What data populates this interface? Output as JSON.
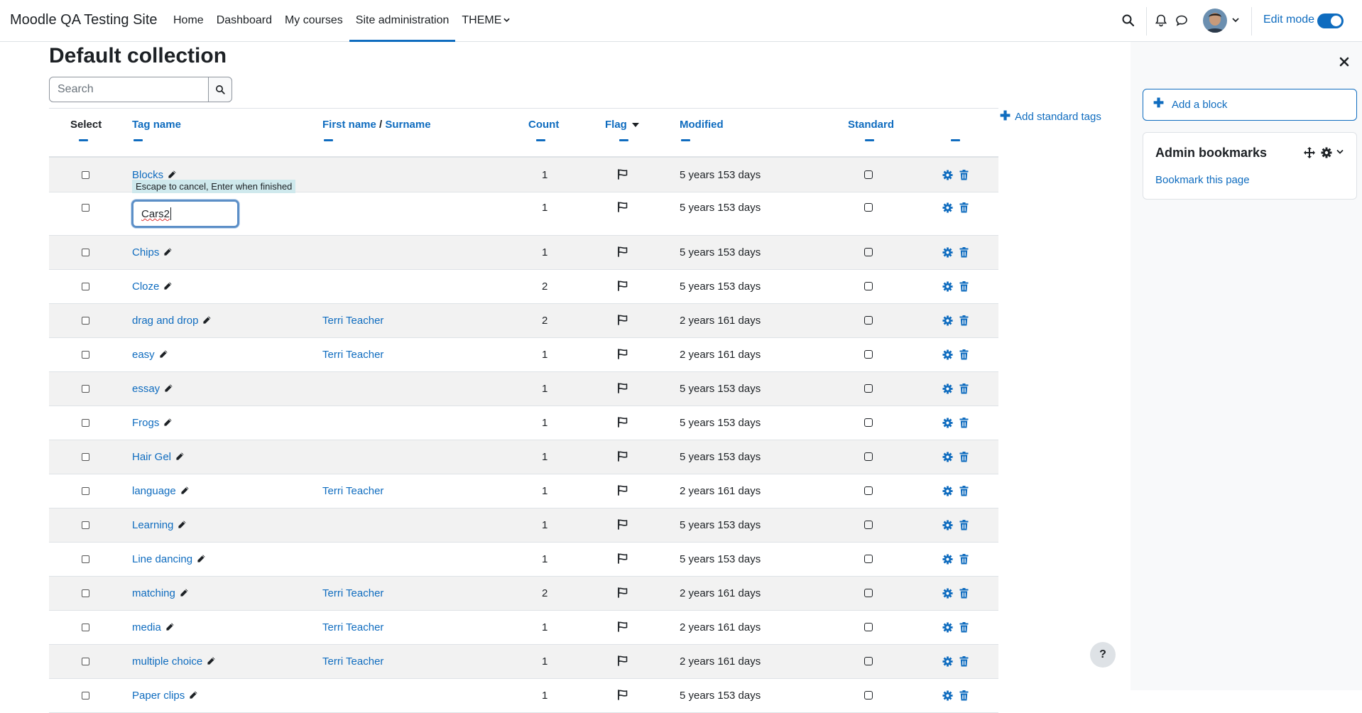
{
  "site": {
    "name": "Moodle QA Testing Site"
  },
  "nav": {
    "items": [
      {
        "label": "Home",
        "name": "nav-home"
      },
      {
        "label": "Dashboard",
        "name": "nav-dashboard"
      },
      {
        "label": "My courses",
        "name": "nav-my-courses"
      },
      {
        "label": "Site administration",
        "name": "nav-site-administration",
        "active": true
      },
      {
        "label": "THEME",
        "name": "nav-theme",
        "dropdown": true
      }
    ],
    "edit_mode_label": "Edit mode",
    "edit_mode_on": true
  },
  "page": {
    "title": "Default collection",
    "search_placeholder": "Search",
    "add_standard_tags": "Add standard tags"
  },
  "table": {
    "headers": {
      "select": "Select",
      "tag_name": "Tag name",
      "first_name": "First name",
      "separator": "/",
      "surname": "Surname",
      "count": "Count",
      "flag": "Flag",
      "modified": "Modified",
      "standard": "Standard"
    },
    "editing": {
      "hint": "Escape to cancel, Enter when finished",
      "value": "Cars2"
    },
    "rows": [
      {
        "tag": "Blocks",
        "user": "",
        "count": "1",
        "modified": "5 years 153 days"
      },
      {
        "tag": "Cars2",
        "user": "",
        "count": "1",
        "modified": "5 years 153 days",
        "editing": true
      },
      {
        "tag": "Chips",
        "user": "",
        "count": "1",
        "modified": "5 years 153 days"
      },
      {
        "tag": "Cloze",
        "user": "",
        "count": "2",
        "modified": "5 years 153 days"
      },
      {
        "tag": "drag and drop",
        "user": "Terri Teacher",
        "count": "2",
        "modified": "2 years 161 days"
      },
      {
        "tag": "easy",
        "user": "Terri Teacher",
        "count": "1",
        "modified": "2 years 161 days"
      },
      {
        "tag": "essay",
        "user": "",
        "count": "1",
        "modified": "5 years 153 days"
      },
      {
        "tag": "Frogs",
        "user": "",
        "count": "1",
        "modified": "5 years 153 days"
      },
      {
        "tag": "Hair Gel",
        "user": "",
        "count": "1",
        "modified": "5 years 153 days"
      },
      {
        "tag": "language",
        "user": "Terri Teacher",
        "count": "1",
        "modified": "2 years 161 days"
      },
      {
        "tag": "Learning",
        "user": "",
        "count": "1",
        "modified": "5 years 153 days"
      },
      {
        "tag": "Line dancing",
        "user": "",
        "count": "1",
        "modified": "5 years 153 days"
      },
      {
        "tag": "matching",
        "user": "Terri Teacher",
        "count": "2",
        "modified": "2 years 161 days"
      },
      {
        "tag": "media",
        "user": "Terri Teacher",
        "count": "1",
        "modified": "2 years 161 days"
      },
      {
        "tag": "multiple choice",
        "user": "Terri Teacher",
        "count": "1",
        "modified": "2 years 161 days"
      },
      {
        "tag": "Paper clips",
        "user": "",
        "count": "1",
        "modified": "5 years 153 days"
      }
    ]
  },
  "drawer": {
    "add_block": "Add a block",
    "block_title": "Admin bookmarks",
    "block_link": "Bookmark this page"
  },
  "help": {
    "label": "?"
  },
  "colors": {
    "link": "#0f6cbf",
    "row_alt": "#f2f2f2",
    "text": "#1d2125"
  }
}
